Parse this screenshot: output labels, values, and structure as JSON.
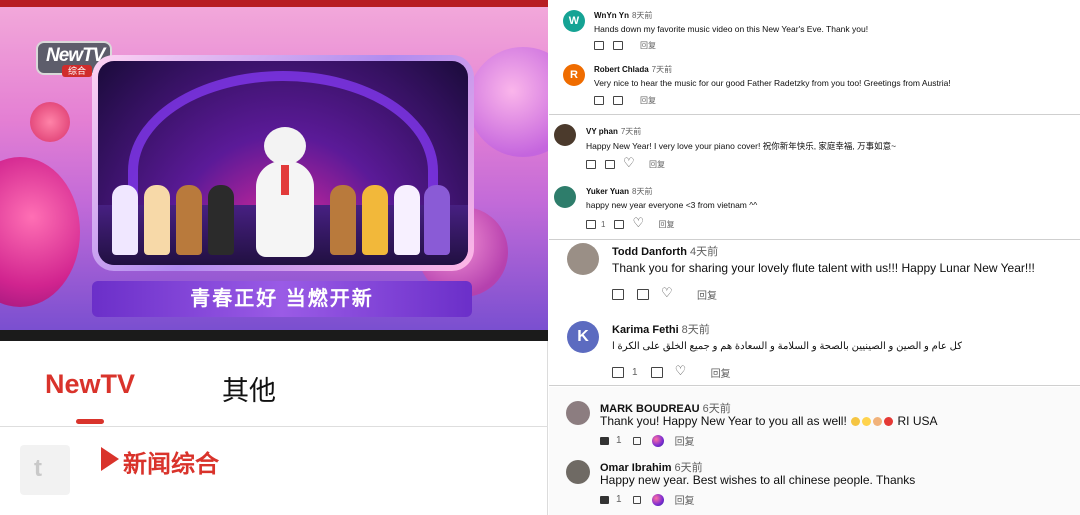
{
  "left": {
    "logo": {
      "text": "NewTV",
      "sub": "综合"
    },
    "video_caption": "青春正好 当燃开新",
    "tabs": [
      {
        "label": "NewTV",
        "active": true
      },
      {
        "label": "其他",
        "active": false
      }
    ],
    "channel": {
      "thumb_glyph": "t",
      "name": "新闻综合"
    },
    "colors": {
      "accent": "#d9332b",
      "top_bar": "#b81d23"
    }
  },
  "comments": [
    {
      "author": "WnYn Yn",
      "time": "8天前",
      "avatar_letter": "W",
      "avatar_color": "#15a394",
      "text": "Hands down my favorite music video on this New Year's Eve. Thank you!",
      "reply": "回复"
    },
    {
      "author": "Robert Chlada",
      "time": "7天前",
      "avatar_letter": "R",
      "avatar_color": "#ef6c00",
      "text": "Very nice to hear the music for our good Father Radetzky from you too! Greetings from Austria!",
      "reply": "回复"
    },
    {
      "author": "VY phan",
      "time": "7天前",
      "avatar_letter": "",
      "avatar_color": "#4b3a2c",
      "text": "Happy New Year! I very love your piano cover! 祝你新年快乐, 家庭幸福, 万事如意~",
      "reply": "回复"
    },
    {
      "author": "Yuker Yuan",
      "time": "8天前",
      "avatar_letter": "",
      "avatar_color": "#2e7d6b",
      "text": "happy new year everyone <3 from vietnam ^^",
      "likes": "1",
      "reply": "回复"
    },
    {
      "author": "Todd Danforth",
      "time": "4天前",
      "avatar_letter": "",
      "avatar_color": "#9a8f86",
      "text": "Thank you for sharing your lovely flute talent with us!!!  Happy Lunar New Year!!!",
      "reply": "回复"
    },
    {
      "author": "Karima Fethi",
      "time": "8天前",
      "avatar_letter": "K",
      "avatar_color": "#5c6bc0",
      "text": "كل عام و الصين و الصينيين بالصحة و السلامة و السعادة  هم و جميع الخلق على الكرة الأرضية ...",
      "likes": "1",
      "reply": "回复"
    },
    {
      "author": "MARK BOUDREAU",
      "time": "6天前",
      "avatar_letter": "",
      "avatar_color": "#8c7d80",
      "text": "Thank you! Happy New Year to you all as well!",
      "text_suffix": "RI USA",
      "likes": "1",
      "reply": "回复"
    },
    {
      "author": "Omar Ibrahim",
      "time": "6天前",
      "avatar_letter": "",
      "avatar_color": "#6f6a64",
      "text": "Happy new year. Best wishes to all chinese people. Thanks",
      "likes": "1",
      "reply": "回复"
    }
  ]
}
